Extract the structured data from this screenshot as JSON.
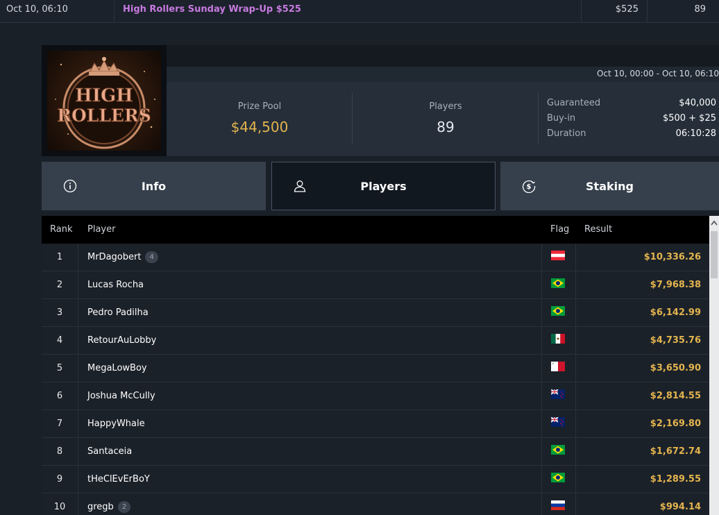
{
  "top_row": {
    "date": "Oct 10, 06:10",
    "name": "High Rollers Sunday Wrap-Up $525",
    "buyin": "$525",
    "players": "89"
  },
  "header": {
    "logo_text": "HIGH ROLLERS",
    "date_range": "Oct 10, 00:00 - Oct 10, 06:10",
    "prize_pool_label": "Prize Pool",
    "prize_pool_value": "$44,500",
    "players_label": "Players",
    "players_value": "89",
    "meta": [
      {
        "label": "Guaranteed",
        "value": "$40,000"
      },
      {
        "label": "Buy-in",
        "value": "$500 + $25"
      },
      {
        "label": "Duration",
        "value": "06:10:28"
      }
    ]
  },
  "tabs": [
    {
      "label": "Info",
      "icon": "info-icon"
    },
    {
      "label": "Players",
      "icon": "user-icon",
      "active": true
    },
    {
      "label": "Staking",
      "icon": "dollar-coin-icon"
    }
  ],
  "table": {
    "columns": {
      "rank": "Rank",
      "player": "Player",
      "flag": "Flag",
      "result": "Result"
    },
    "rows": [
      {
        "rank": "1",
        "player": "MrDagobert",
        "badge": "4",
        "flag": "austria",
        "result": "$10,336.26"
      },
      {
        "rank": "2",
        "player": "Lucas Rocha",
        "badge": "",
        "flag": "brazil",
        "result": "$7,968.38"
      },
      {
        "rank": "3",
        "player": "Pedro Padilha",
        "badge": "",
        "flag": "brazil",
        "result": "$6,142.99"
      },
      {
        "rank": "4",
        "player": "RetourAuLobby",
        "badge": "",
        "flag": "mexico",
        "result": "$4,735.76"
      },
      {
        "rank": "5",
        "player": "MegaLowBoy",
        "badge": "",
        "flag": "malta",
        "result": "$3,650.90"
      },
      {
        "rank": "6",
        "player": "Joshua McCully",
        "badge": "",
        "flag": "new-zealand",
        "result": "$2,814.55"
      },
      {
        "rank": "7",
        "player": "HappyWhale",
        "badge": "",
        "flag": "new-zealand",
        "result": "$2,169.80"
      },
      {
        "rank": "8",
        "player": "Santaceia",
        "badge": "",
        "flag": "brazil",
        "result": "$1,672.74"
      },
      {
        "rank": "9",
        "player": "tHeClEvErBoY",
        "badge": "",
        "flag": "brazil",
        "result": "$1,289.55"
      },
      {
        "rank": "10",
        "player": "gregb",
        "badge": "2",
        "flag": "russia",
        "result": "$994.14"
      }
    ]
  }
}
